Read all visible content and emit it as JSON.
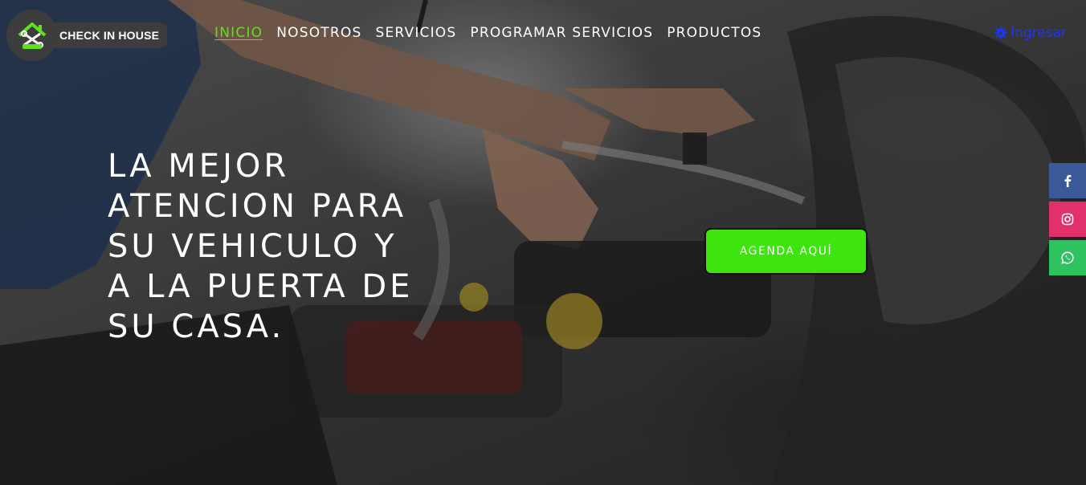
{
  "brand": {
    "name": "CHECK IN HOUSE",
    "accent": "#5fe21a"
  },
  "nav": {
    "items": [
      {
        "label": "INICIO",
        "active": true
      },
      {
        "label": "NOSOTROS",
        "active": false
      },
      {
        "label": "SERVICIOS",
        "active": false
      },
      {
        "label": "PROGRAMAR SERVICIOS",
        "active": false
      },
      {
        "label": "PRODUCTOS",
        "active": false
      }
    ],
    "login_label": "Ingresar",
    "login_icon": "gear-icon"
  },
  "hero": {
    "title": "LA MEJOR ATENCION PARA SU VEHICULO Y A LA PUERTA DE SU CASA.",
    "cta_label": "AGENDA AQUÍ",
    "cta_color": "#3ee40d"
  },
  "social": [
    {
      "name": "facebook-icon",
      "color": "#3b5998"
    },
    {
      "name": "instagram-icon",
      "color": "#e1306c"
    },
    {
      "name": "whatsapp-icon",
      "color": "#2fc35f"
    }
  ]
}
